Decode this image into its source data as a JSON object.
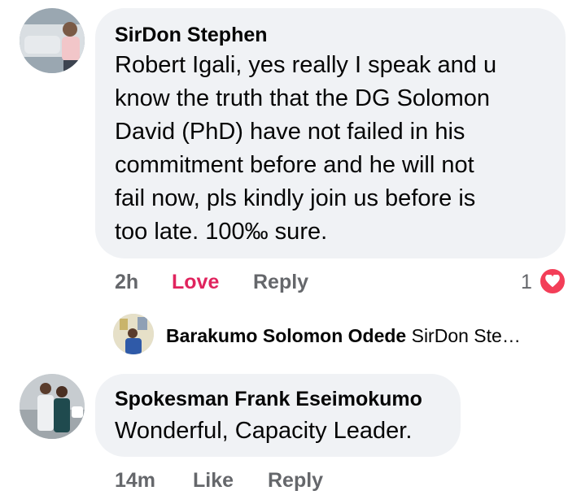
{
  "comments": [
    {
      "author": "SirDon Stephen",
      "text_lines": [
        "Robert Igali, yes really  I speak and u",
        "know the truth  that the DG Solomon",
        "David (PhD) have not failed in his",
        "commitment before and he will not",
        "fail now,  pls kindly join us before is",
        "too late. 100‰ sure."
      ],
      "time": "2h",
      "love_label": "Love",
      "reply_label": "Reply",
      "reaction_count": "1",
      "reaction_icon": "heart-icon"
    },
    {
      "author": "Spokesman Frank Eseimokumo",
      "text": "Wonderful, Capacity Leader.",
      "time": "14m",
      "like_label": "Like",
      "reply_label": "Reply"
    }
  ],
  "reply_preview": {
    "author": "Barakumo Solomon Odede",
    "snippet": "SirDon Ste…"
  },
  "colors": {
    "bubble": "#f0f2f5",
    "love": "#e0245e",
    "heart_badge": "#f33e58",
    "meta": "#65676b"
  }
}
